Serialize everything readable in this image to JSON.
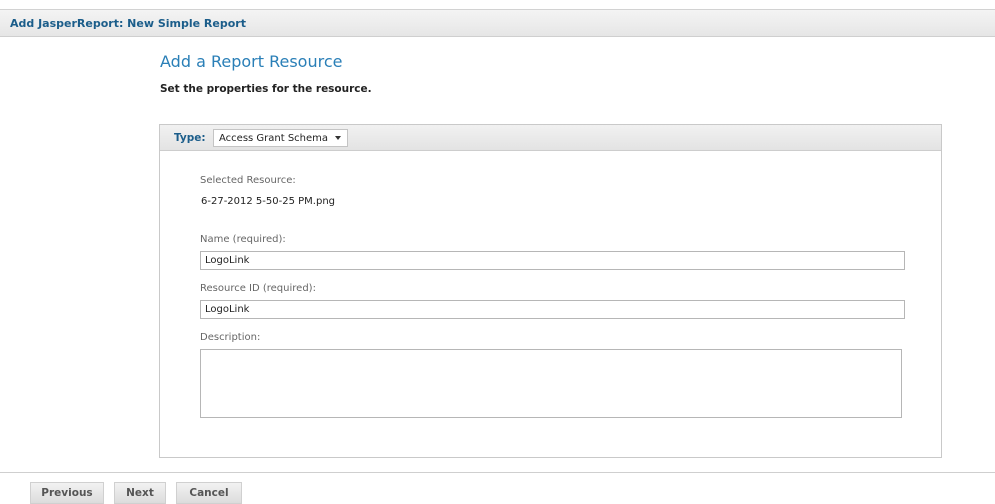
{
  "window": {
    "title": "Add JasperReport: New Simple Report"
  },
  "page": {
    "heading": "Add a Report Resource",
    "subheading": "Set the properties for the resource."
  },
  "type_selector": {
    "label": "Type:",
    "selected": "Access Grant Schema"
  },
  "form": {
    "selected_resource_label": "Selected Resource:",
    "selected_resource_value": "6-27-2012 5-50-25 PM.png",
    "name_label": "Name (required):",
    "name_value": "LogoLink",
    "resource_id_label": "Resource ID (required):",
    "resource_id_value": "LogoLink",
    "description_label": "Description:",
    "description_value": ""
  },
  "footer": {
    "previous_label": "Previous",
    "next_label": "Next",
    "cancel_label": "Cancel"
  }
}
